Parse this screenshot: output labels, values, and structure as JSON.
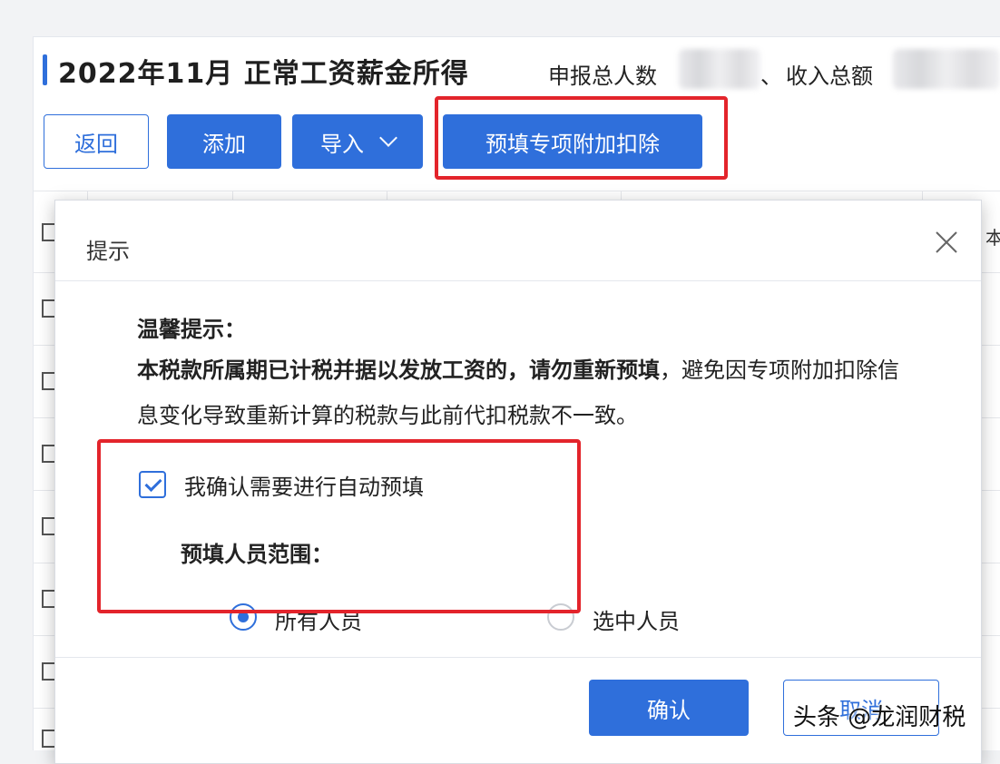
{
  "header": {
    "title": "2022年11月 正常工资薪金所得",
    "declared_people_label": "申报总人数",
    "declared_people_suffix": "、",
    "total_income_label": "收入总额"
  },
  "toolbar": {
    "back_label": "返回",
    "add_label": "添加",
    "import_label": "导入",
    "prefill_label": "预填专项附加扣除"
  },
  "table": {
    "partial_header": "本"
  },
  "dialog": {
    "title": "提示",
    "heading": "温馨提示：",
    "bold_text": "本税款所属期已计税并据以发放工资的，请勿重新预填",
    "normal_text": "，避免因专项附加扣除信息变化导致重新计算的税款与此前代扣税款不一致。",
    "confirm_checkbox_label": "我确认需要进行自动预填",
    "confirm_checked": true,
    "range_label": "预填人员范围：",
    "range_options": [
      {
        "label": "所有人员",
        "selected": true
      },
      {
        "label": "选中人员",
        "selected": false
      }
    ],
    "ok_label": "确认",
    "cancel_label": "取消"
  },
  "watermark": "头条 @龙润财税",
  "colors": {
    "primary": "#2f6fdb",
    "highlight": "#e3242b"
  },
  "icons": {
    "close": "close-icon",
    "dropdown": "chevron-down-icon"
  }
}
